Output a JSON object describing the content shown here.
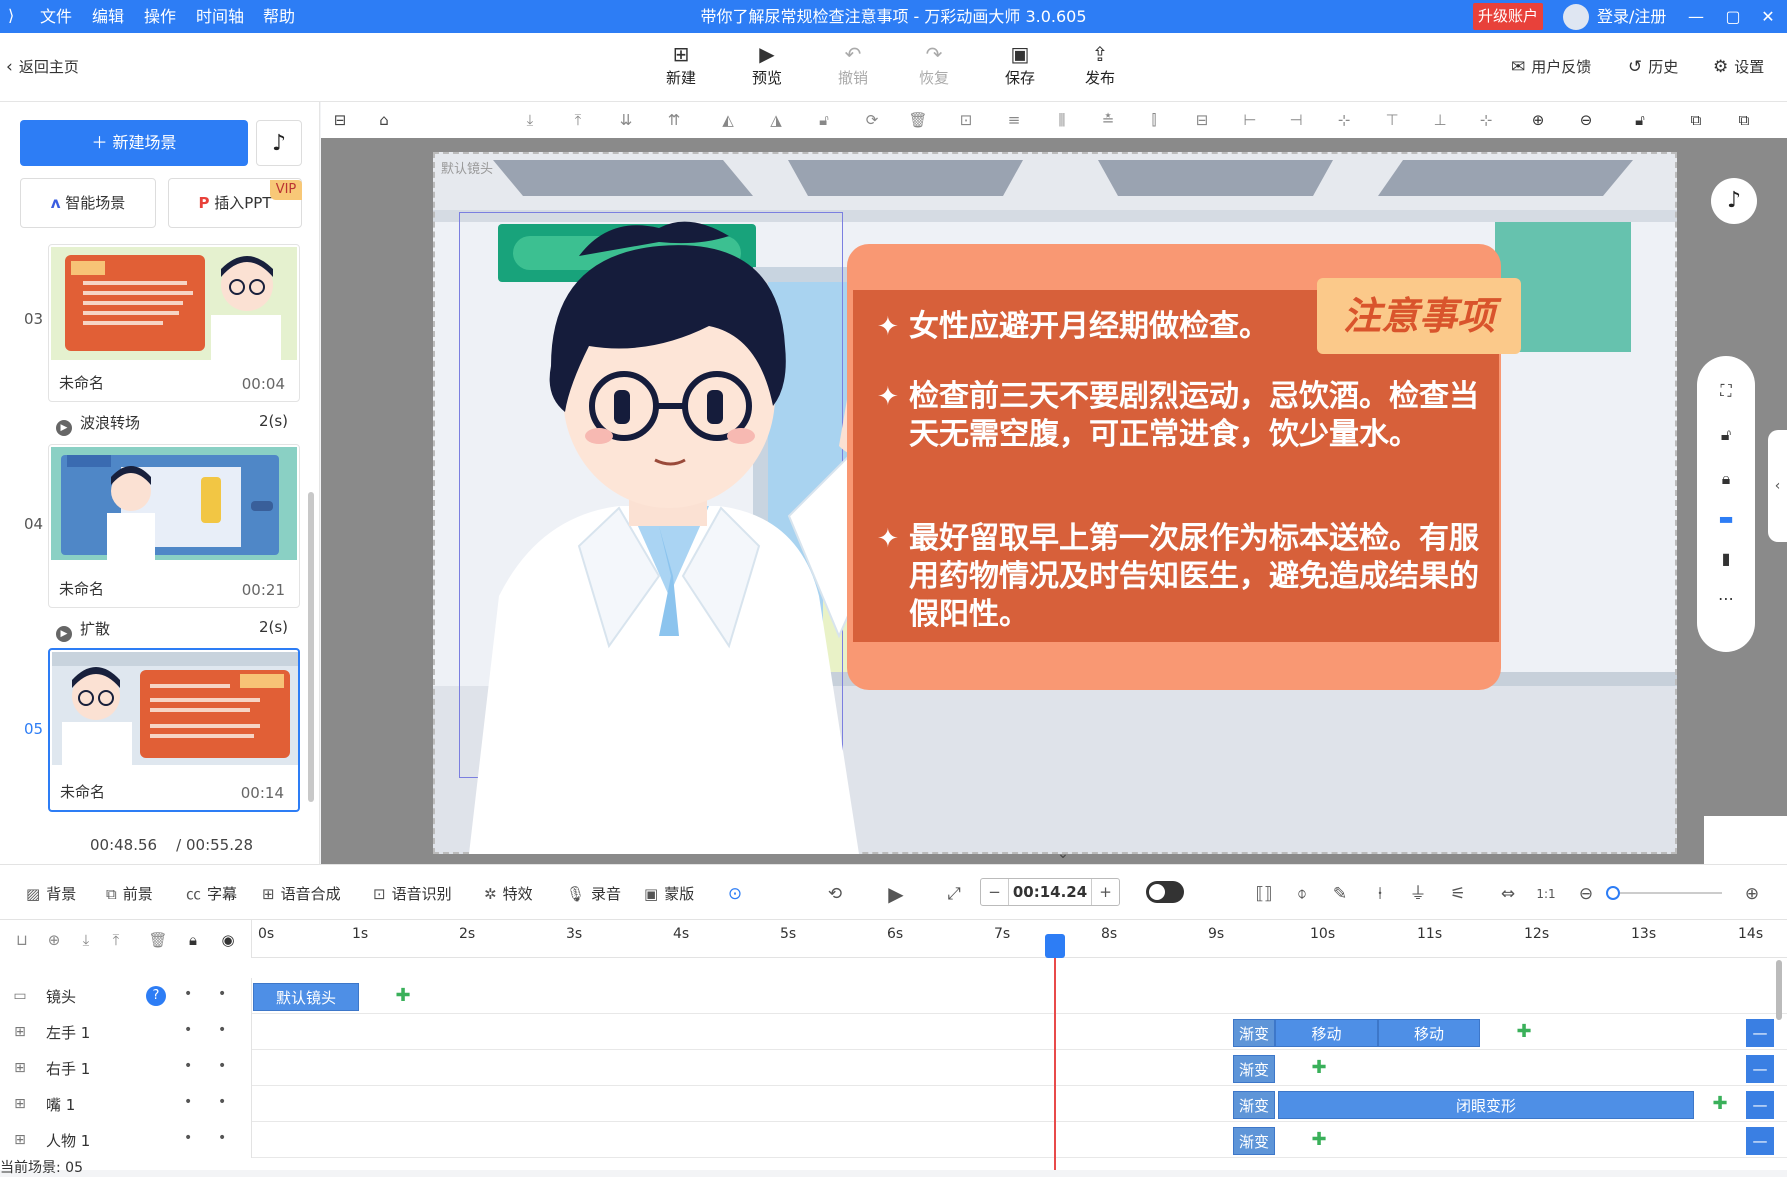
{
  "titlebar": {
    "menus": [
      "文件",
      "编辑",
      "操作",
      "时间轴",
      "帮助"
    ],
    "title": "带你了解尿常规检查注意事项 - 万彩动画大师 3.0.605",
    "upgrade": "升级账户",
    "login": "登录/注册",
    "accent": "#2d7df5"
  },
  "toolbar": {
    "back": "返回主页",
    "new": "新建",
    "preview": "预览",
    "undo": "撤销",
    "redo": "恢复",
    "save": "保存",
    "publish": "发布",
    "feedback": "用户反馈",
    "history": "历史",
    "settings": "设置"
  },
  "leftpanel": {
    "new_scene": "新建场景",
    "smart_scene": "智能场景",
    "insert_ppt": "插入PPT",
    "vip": "VIP",
    "scenes": [
      {
        "num": "03",
        "name": "未命名",
        "duration": "00:04"
      },
      {
        "num": "04",
        "name": "未命名",
        "duration": "00:21"
      },
      {
        "num": "05",
        "name": "未命名",
        "duration": "00:14"
      }
    ],
    "transitions": [
      {
        "name": "波浪转场",
        "time": "2(s)"
      },
      {
        "name": "扩散",
        "time": "2(s)"
      }
    ],
    "elapsed": "00:48.56",
    "total": "/ 00:55.28"
  },
  "canvas": {
    "stage_label": "默认镜头",
    "notice_title": "注意事项",
    "bullets": [
      "女性应避开月经期做检查。",
      "检查前三天不要剧烈运动，忌饮酒。检查当天无需空腹，可正常进食，饮少量水。",
      "最好留取早上第一次尿作为标本送检。有服用药物情况及时告知医生，避免造成结果的假阳性。"
    ]
  },
  "bottombar": {
    "background": "背景",
    "foreground": "前景",
    "subtitle": "字幕",
    "tts": "语音合成",
    "asr": "语音识别",
    "effects": "特效",
    "record": "录音",
    "mask": "蒙版",
    "current_time": "00:14.24"
  },
  "timeline": {
    "ticks": [
      "0s",
      "1s",
      "2s",
      "3s",
      "4s",
      "5s",
      "6s",
      "7s",
      "8s",
      "9s",
      "10s",
      "11s",
      "12s",
      "13s",
      "14s"
    ],
    "tracks": [
      {
        "name": "镜头"
      },
      {
        "name": "左手 1"
      },
      {
        "name": "右手 1"
      },
      {
        "name": "嘴 1"
      },
      {
        "name": "人物 1"
      }
    ],
    "blocks": {
      "default_camera": "默认镜头",
      "fade": "渐变",
      "move": "移动",
      "close_eye": "闭眼变形"
    },
    "current_scene": "当前场景: 05"
  }
}
